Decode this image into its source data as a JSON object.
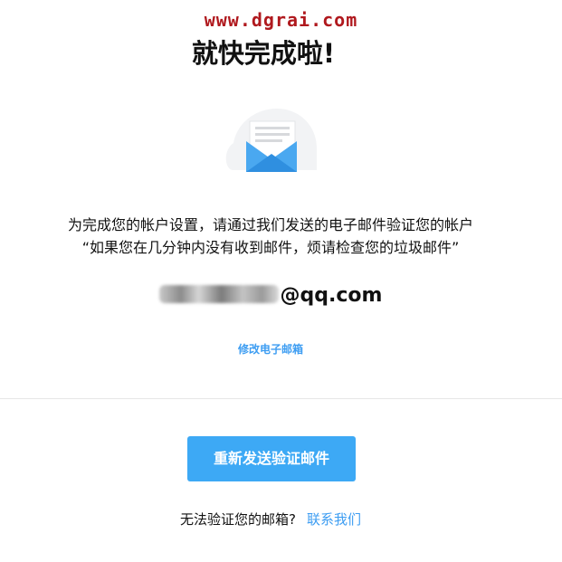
{
  "watermark": "www.dgrai.com",
  "title": "就快完成啦!",
  "message": {
    "line1": "为完成您的帐户设置，请通过我们发送的电子邮件验证您的帐户",
    "line2": "“如果您在几分钟内没有收到邮件，烦请检查您的垃圾邮件”"
  },
  "email": {
    "visible_suffix": "@qq.com"
  },
  "change_email_label": "修改电子邮箱",
  "resend_button_label": "重新发送验证邮件",
  "help": {
    "question": "无法验证您的邮箱?",
    "contact_label": "联系我们"
  },
  "colors": {
    "accent": "#3da9f5",
    "link": "#3d9df2",
    "watermark": "#b0191e",
    "envelope": "#4aa8f0"
  },
  "icons": {
    "illustration": "email-envelope-icon"
  }
}
